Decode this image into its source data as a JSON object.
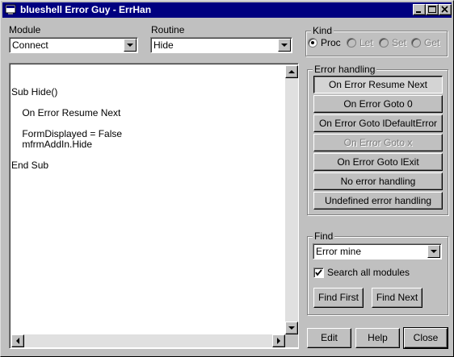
{
  "window": {
    "title": "blueshell Error Guy - ErrHan"
  },
  "module": {
    "label": "Module",
    "value": "Connect"
  },
  "routine": {
    "label": "Routine",
    "value": "Hide"
  },
  "kind": {
    "title": "Kind",
    "options": [
      {
        "label": "Proc",
        "selected": true,
        "enabled": true
      },
      {
        "label": "Let",
        "selected": false,
        "enabled": false
      },
      {
        "label": "Set",
        "selected": false,
        "enabled": false
      },
      {
        "label": "Get",
        "selected": false,
        "enabled": false
      }
    ]
  },
  "code": {
    "lines": [
      "Sub Hide()",
      "",
      "    On Error Resume Next",
      "",
      "    FormDisplayed = False",
      "    mfrmAddIn.Hide",
      "",
      "End Sub"
    ]
  },
  "error_handling": {
    "title": "Error handling",
    "buttons": [
      {
        "label": "On Error Resume Next",
        "state": "pressed"
      },
      {
        "label": "On Error Goto 0",
        "state": "normal"
      },
      {
        "label": "On Error Goto lDefaultError",
        "state": "normal"
      },
      {
        "label": "On Error Goto x",
        "state": "disabled"
      },
      {
        "label": "On Error Goto lExit",
        "state": "normal"
      },
      {
        "label": "No error handling",
        "state": "normal"
      },
      {
        "label": "Undefined error handling",
        "state": "normal"
      }
    ]
  },
  "find": {
    "title": "Find",
    "value": "Error mine",
    "search_all_label": "Search all modules",
    "search_all_checked": true,
    "find_first": "Find First",
    "find_next": "Find Next"
  },
  "bottom_buttons": {
    "edit": "Edit",
    "help": "Help",
    "close": "Close"
  },
  "colors": {
    "titlebar": "#000080",
    "face": "#c0c0c0"
  }
}
